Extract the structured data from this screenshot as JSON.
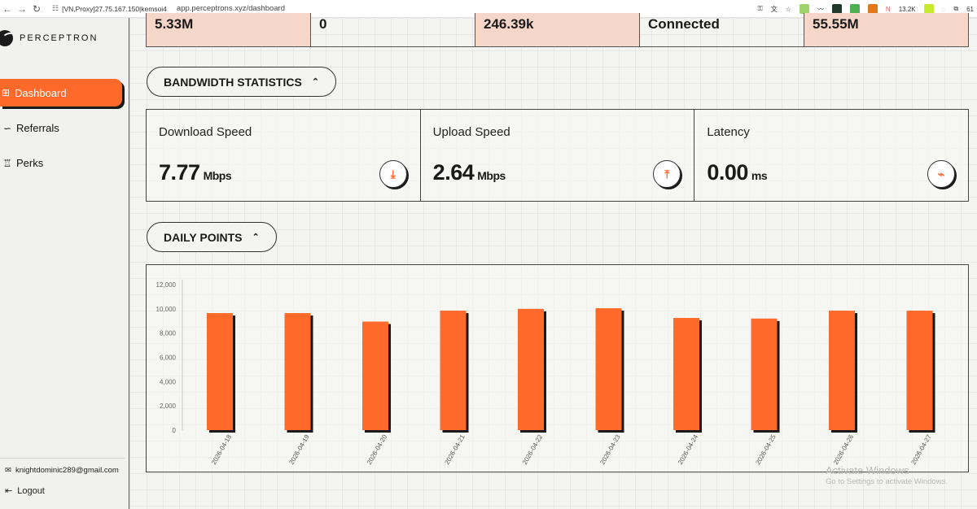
{
  "browser": {
    "proxy_label": "[VN,Proxy]27.75.167.150|kemsoi4",
    "url": "app.perceptrons.xyz/dashboard",
    "ext_badge": "13.2K",
    "profile_count": "61"
  },
  "sidebar": {
    "brand": "PERCEPTRON",
    "items": [
      {
        "label": "Dashboard"
      },
      {
        "label": "Referrals"
      },
      {
        "label": "Perks"
      }
    ],
    "email": "knightdominic289@gmail.com",
    "logout": "Logout"
  },
  "stats": [
    "5.33M",
    "0",
    "246.39k",
    "Connected",
    "55.55M"
  ],
  "bandwidth": {
    "section_title": "BANDWIDTH STATISTICS",
    "download": {
      "title": "Download Speed",
      "value": "7.77",
      "unit": "Mbps"
    },
    "upload": {
      "title": "Upload Speed",
      "value": "2.64",
      "unit": "Mbps"
    },
    "latency": {
      "title": "Latency",
      "value": "0.00",
      "unit": "ms"
    }
  },
  "daily": {
    "section_title": "DAILY POINTS"
  },
  "chart_data": {
    "type": "bar",
    "categories": [
      "2026-04-18",
      "2026-04-19",
      "2026-04-20",
      "2026-04-21",
      "2026-04-22",
      "2026-04-23",
      "2026-04-24",
      "2026-04-25",
      "2026-04-26",
      "2026-04-27"
    ],
    "values": [
      9650,
      9650,
      8950,
      9850,
      10000,
      10050,
      9250,
      9200,
      9850,
      9850
    ],
    "yticks": [
      "12,000",
      "10,000",
      "8,000",
      "6,000",
      "4,000",
      "2,000",
      "0"
    ],
    "ylim": [
      0,
      12000
    ],
    "bar_color": "#ff6a2b",
    "grid": false
  },
  "watermark": {
    "title": "Activate Windows",
    "subtitle": "Go to Settings to activate Windows."
  },
  "colors": {
    "accent": "#ff6a2b",
    "stat_peach": "#f6d6c8"
  }
}
